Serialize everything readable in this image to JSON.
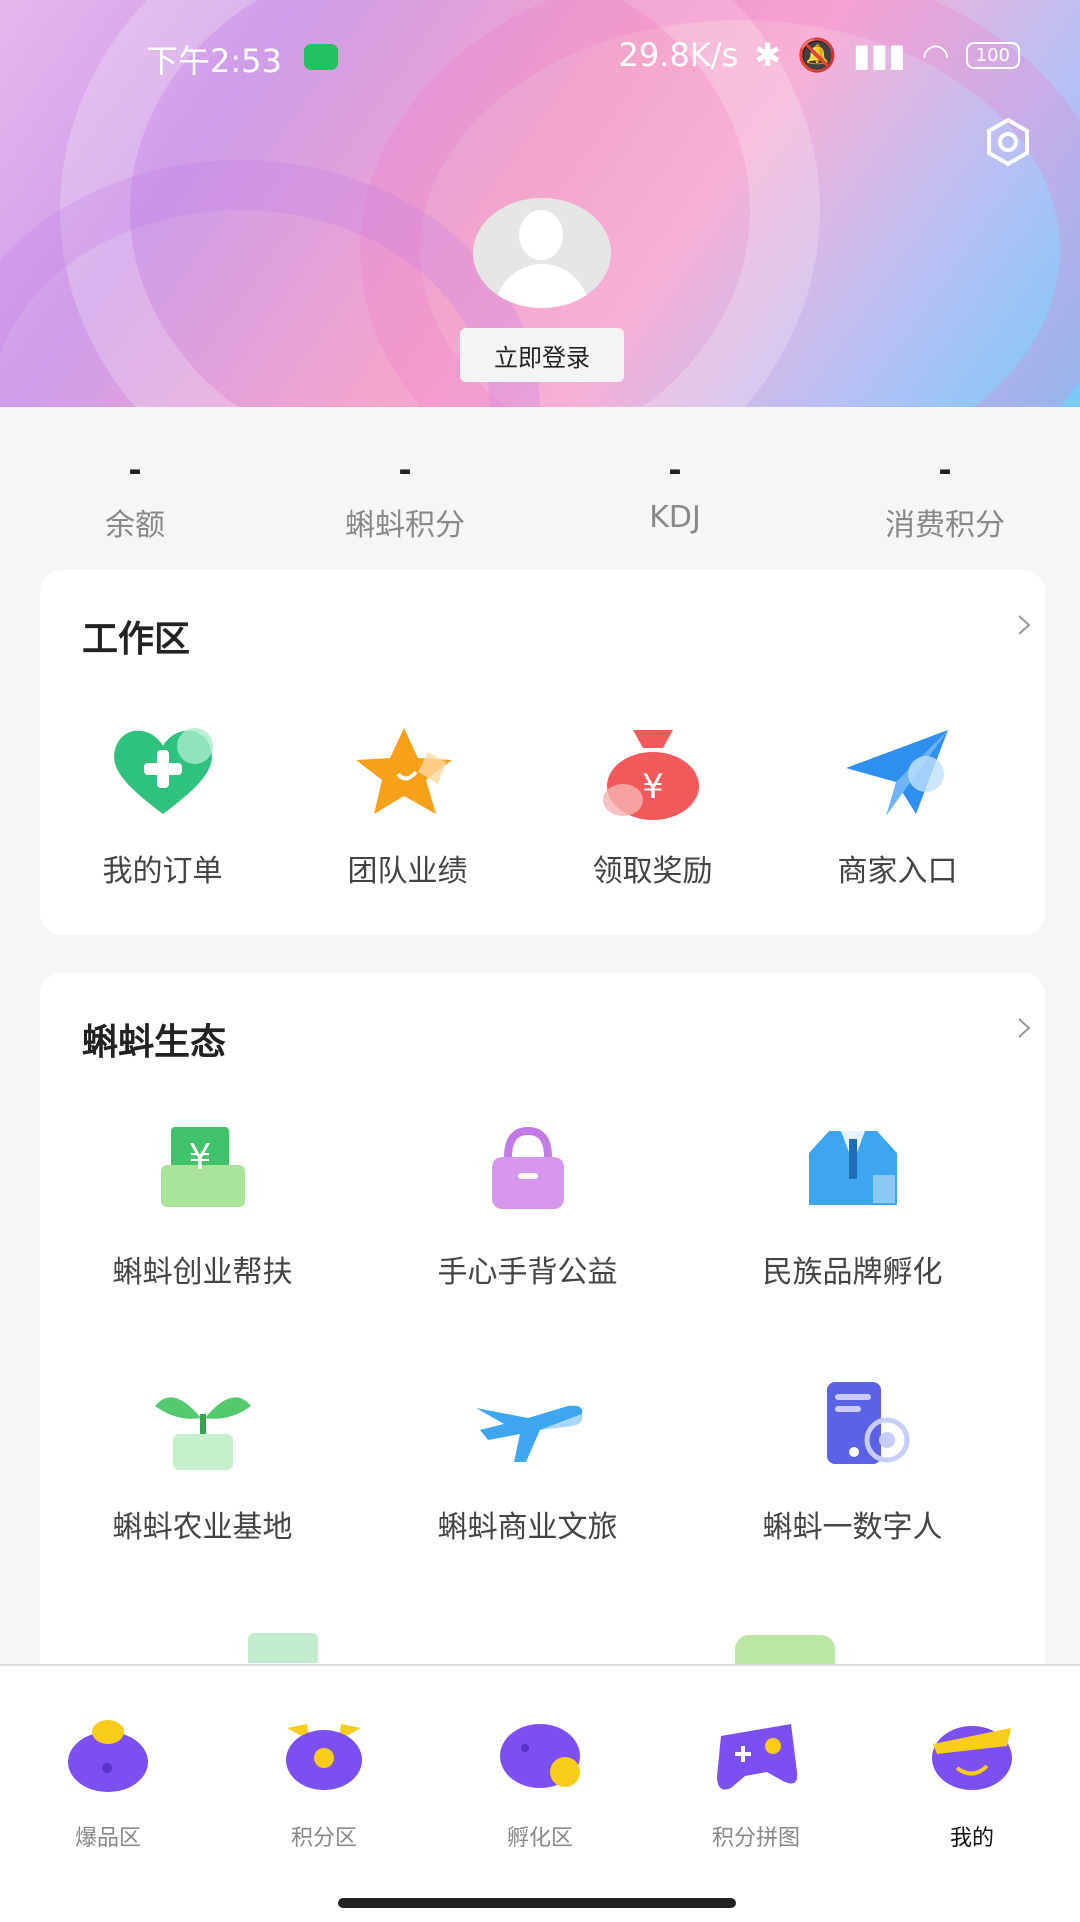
{
  "status_bar": {
    "time": "下午2:53",
    "net_speed": "29.8K/s",
    "battery": "100"
  },
  "profile": {
    "login_label": "立即登录"
  },
  "stats": [
    {
      "value": "-",
      "label": "余额"
    },
    {
      "value": "-",
      "label": "蝌蚪积分"
    },
    {
      "value": "-",
      "label": "KDJ"
    },
    {
      "value": "-",
      "label": "消费积分"
    }
  ],
  "workspace": {
    "title": "工作区",
    "items": [
      {
        "label": "我的订单",
        "icon": "heart-plus-icon"
      },
      {
        "label": "团队业绩",
        "icon": "star-icon"
      },
      {
        "label": "领取奖励",
        "icon": "money-bag-icon"
      },
      {
        "label": "商家入口",
        "icon": "paper-plane-icon"
      }
    ]
  },
  "ecosystem": {
    "title": "蝌蚪生态",
    "items": [
      {
        "label": "蝌蚪创业帮扶",
        "icon": "yuan-envelope-icon"
      },
      {
        "label": "手心手背公益",
        "icon": "handbag-icon"
      },
      {
        "label": "民族品牌孵化",
        "icon": "suit-icon"
      },
      {
        "label": "蝌蚪农业基地",
        "icon": "sprout-icon"
      },
      {
        "label": "蝌蚪商业文旅",
        "icon": "airplane-icon"
      },
      {
        "label": "蝌蚪一数字人",
        "icon": "digital-device-icon"
      }
    ]
  },
  "tabbar": [
    {
      "label": "爆品区",
      "active": false
    },
    {
      "label": "积分区",
      "active": false
    },
    {
      "label": "孵化区",
      "active": false
    },
    {
      "label": "积分拼图",
      "active": false
    },
    {
      "label": "我的",
      "active": true
    }
  ],
  "colors": {
    "accent_purple": "#7b4ff0",
    "accent_yellow": "#f8cc1a",
    "green": "#2ec27e",
    "blue": "#2f8ff0",
    "red": "#f05a5a"
  }
}
